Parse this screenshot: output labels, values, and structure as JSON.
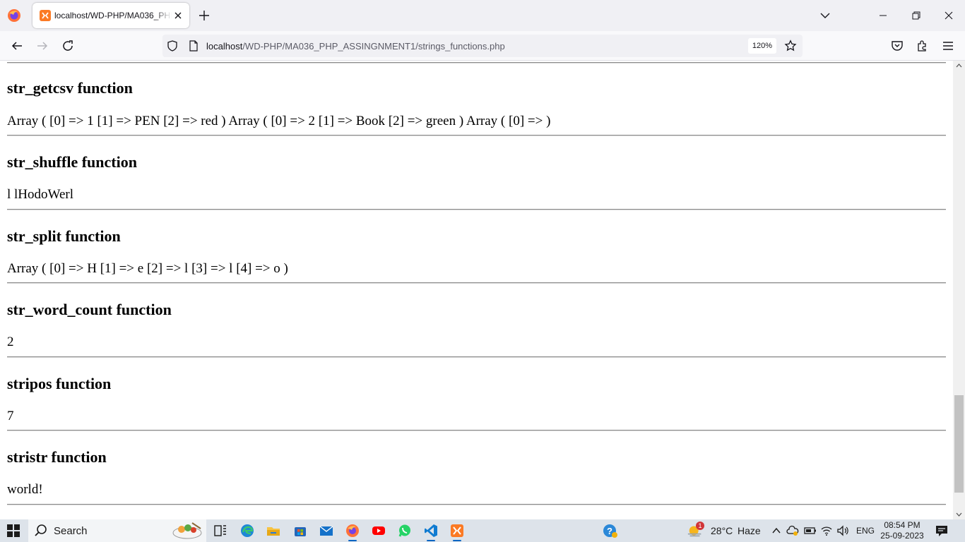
{
  "browser": {
    "tab_title": "localhost/WD-PHP/MA036_PHP",
    "url_host": "localhost",
    "url_path": "/WD-PHP/MA036_PHP_ASSINGNMENT1/strings_functions.php",
    "zoom": "120%"
  },
  "sections": [
    {
      "title": "str_getcsv function",
      "output": "Array ( [0] => 1 [1] => PEN [2] => red ) Array ( [0] => 2 [1] => Book [2] => green ) Array ( [0] => )"
    },
    {
      "title": "str_shuffle function",
      "output": "l lHodoWerl"
    },
    {
      "title": "str_split function",
      "output": "Array ( [0] => H [1] => e [2] => l [3] => l [4] => o )"
    },
    {
      "title": "str_word_count function",
      "output": "2"
    },
    {
      "title": "stripos function",
      "output": "7"
    },
    {
      "title": "stristr function",
      "output": "world!"
    }
  ],
  "taskbar": {
    "search_label": "Search",
    "weather_temp": "28°C",
    "weather_desc": "Haze",
    "weather_badge": "1",
    "language": "ENG",
    "time": "08:54 PM",
    "date": "25-09-2023"
  },
  "colors": {
    "accent_blue": "#0a64c2",
    "rule": "#8c8c8c",
    "firefox_orange": "#ff7139"
  }
}
